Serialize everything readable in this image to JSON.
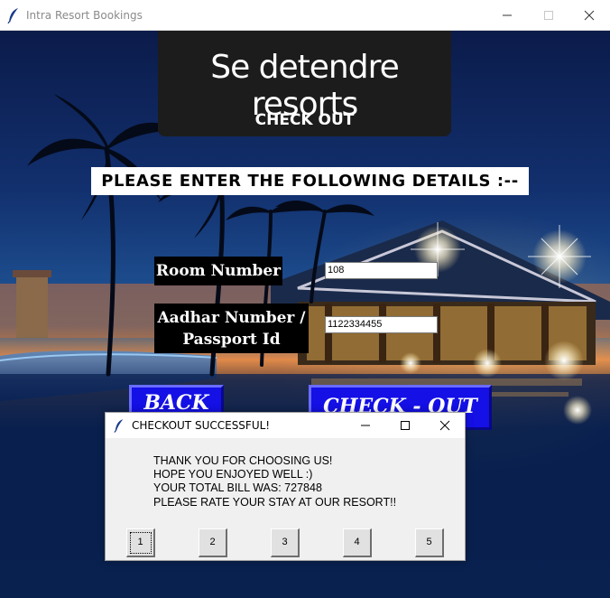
{
  "window": {
    "title": "Intra Resort Bookings",
    "icon": "feather-icon"
  },
  "header": {
    "brand": "Se detendre resorts",
    "subtitle": "CHECK OUT"
  },
  "form": {
    "instruction": "PLEASE ENTER THE FOLLOWING DETAILS :--",
    "room_label": "Room Number",
    "room_value": "108",
    "aadhar_label_line1": "Aadhar Number /",
    "aadhar_label_line2": "Passport Id",
    "aadhar_value": "1122334455"
  },
  "buttons": {
    "back": "BACK",
    "checkout": "CHECK - OUT"
  },
  "dialog": {
    "title": "CHECKOUT SUCCESSFUL!",
    "lines": [
      "THANK YOU FOR CHOOSING US!",
      "HOPE YOU ENJOYED WELL :)",
      "YOUR TOTAL BILL WAS: 727848",
      "PLEASE RATE YOUR STAY AT OUR RESORT!!"
    ],
    "ratings": [
      "1",
      "2",
      "3",
      "4",
      "5"
    ]
  },
  "colors": {
    "button_blue": "#1410e6",
    "banner_bg": "#1c1c1c"
  }
}
